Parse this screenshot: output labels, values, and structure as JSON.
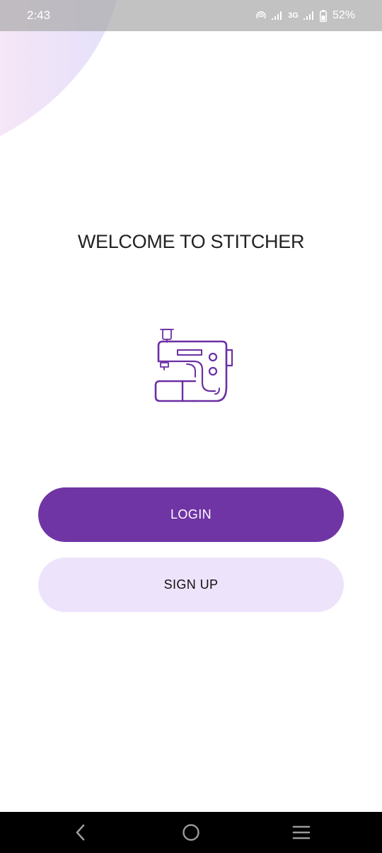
{
  "status_bar": {
    "time": "2:43",
    "network_label": "3G",
    "battery_percent": "52%"
  },
  "welcome": {
    "title": "WELCOME TO STITCHER",
    "logo_icon": "sewing-machine-icon"
  },
  "actions": {
    "login_label": "LOGIN",
    "signup_label": "SIGN UP"
  },
  "nav_bar": {
    "back_icon": "back-chevron-icon",
    "home_icon": "home-circle-icon",
    "menu_icon": "menu-lines-icon"
  },
  "colors": {
    "accent": "#7035a5",
    "secondary_button": "#ede3fb",
    "logo_stroke": "#6b2fa3"
  }
}
